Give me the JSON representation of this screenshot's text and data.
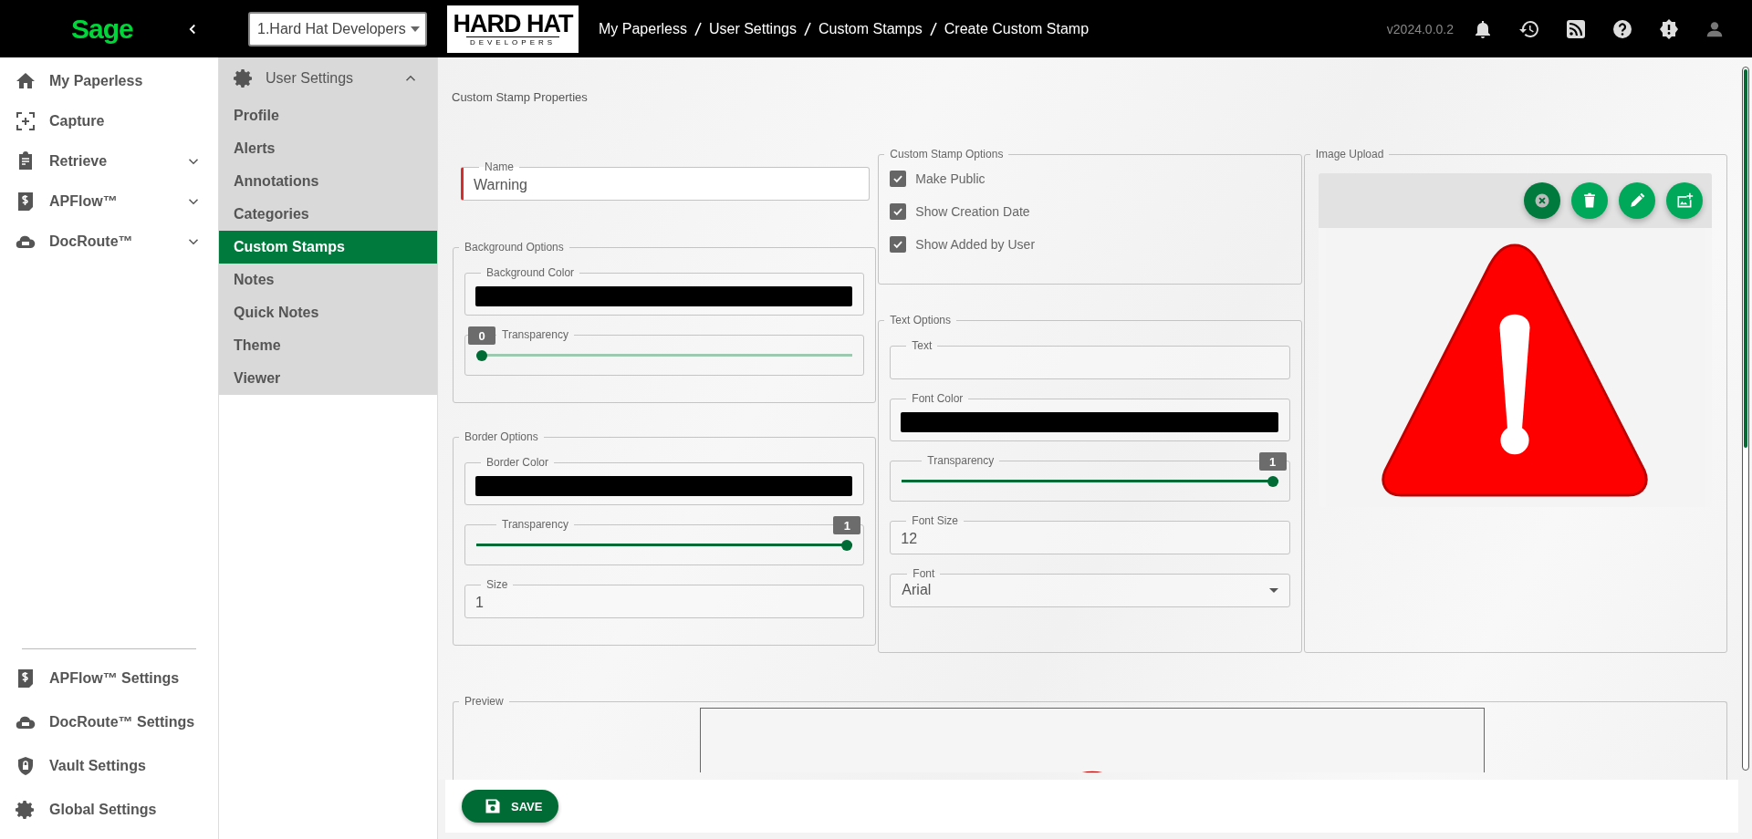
{
  "topbar": {
    "brand": "Sage",
    "company_select": "1.Hard Hat Developers",
    "logo": {
      "line1": "HARD HAT",
      "line2": "DEVELOPERS"
    },
    "breadcrumb": [
      "My Paperless",
      "User Settings",
      "Custom Stamps",
      "Create Custom Stamp"
    ],
    "version": "v2024.0.0.2"
  },
  "nav": {
    "items": [
      {
        "label": "My Paperless",
        "expandable": false
      },
      {
        "label": "Capture",
        "expandable": false
      },
      {
        "label": "Retrieve",
        "expandable": true
      },
      {
        "label": "APFlow™",
        "expandable": true
      },
      {
        "label": "DocRoute™",
        "expandable": true
      }
    ],
    "bottom_items": [
      {
        "label": "APFlow™ Settings"
      },
      {
        "label": "DocRoute™ Settings"
      },
      {
        "label": "Vault Settings"
      },
      {
        "label": "Global Settings"
      }
    ]
  },
  "subnav": {
    "title": "User Settings",
    "expanded": true,
    "items": [
      {
        "label": "Profile",
        "selected": false
      },
      {
        "label": "Alerts",
        "selected": false
      },
      {
        "label": "Annotations",
        "selected": false
      },
      {
        "label": "Categories",
        "selected": false
      },
      {
        "label": "Custom Stamps",
        "selected": true
      },
      {
        "label": "Notes",
        "selected": false
      },
      {
        "label": "Quick Notes",
        "selected": false
      },
      {
        "label": "Theme",
        "selected": false
      },
      {
        "label": "Viewer",
        "selected": false
      }
    ]
  },
  "form": {
    "title": "Custom Stamp Properties",
    "name_field": {
      "label": "Name",
      "value": "Warning",
      "error": true
    },
    "background_options": {
      "title": "Background Options",
      "color": {
        "label": "Background Color",
        "color": "#000000"
      },
      "transparency": {
        "label": "Transparency",
        "level": 0,
        "reading": "0"
      }
    },
    "border_options": {
      "title": "Border Options",
      "color": {
        "label": "Border Color",
        "color": "#000000"
      },
      "transparency": {
        "label": "Transparency",
        "level": 1,
        "reading": "1"
      },
      "size": {
        "label": "Size",
        "value": "1"
      }
    },
    "stamp_options": {
      "title": "Custom Stamp Options",
      "checkboxes": [
        {
          "label": "Make Public",
          "checked": true
        },
        {
          "label": "Show Creation Date",
          "checked": true
        },
        {
          "label": "Show Added by User",
          "checked": true
        }
      ]
    },
    "text_options": {
      "title": "Text Options",
      "text": {
        "label": "Text"
      },
      "font_color": {
        "label": "Font Color",
        "color": "#000000"
      },
      "transparency": {
        "label": "Transparency",
        "level": 1,
        "reading": "1"
      },
      "font_size": {
        "label": "Font Size",
        "value": "12"
      },
      "font": {
        "label": "Font",
        "value": "Arial"
      }
    },
    "image_upload": {
      "title": "Image Upload"
    },
    "preview": {
      "title": "Preview"
    },
    "save_button": "SAVE"
  }
}
